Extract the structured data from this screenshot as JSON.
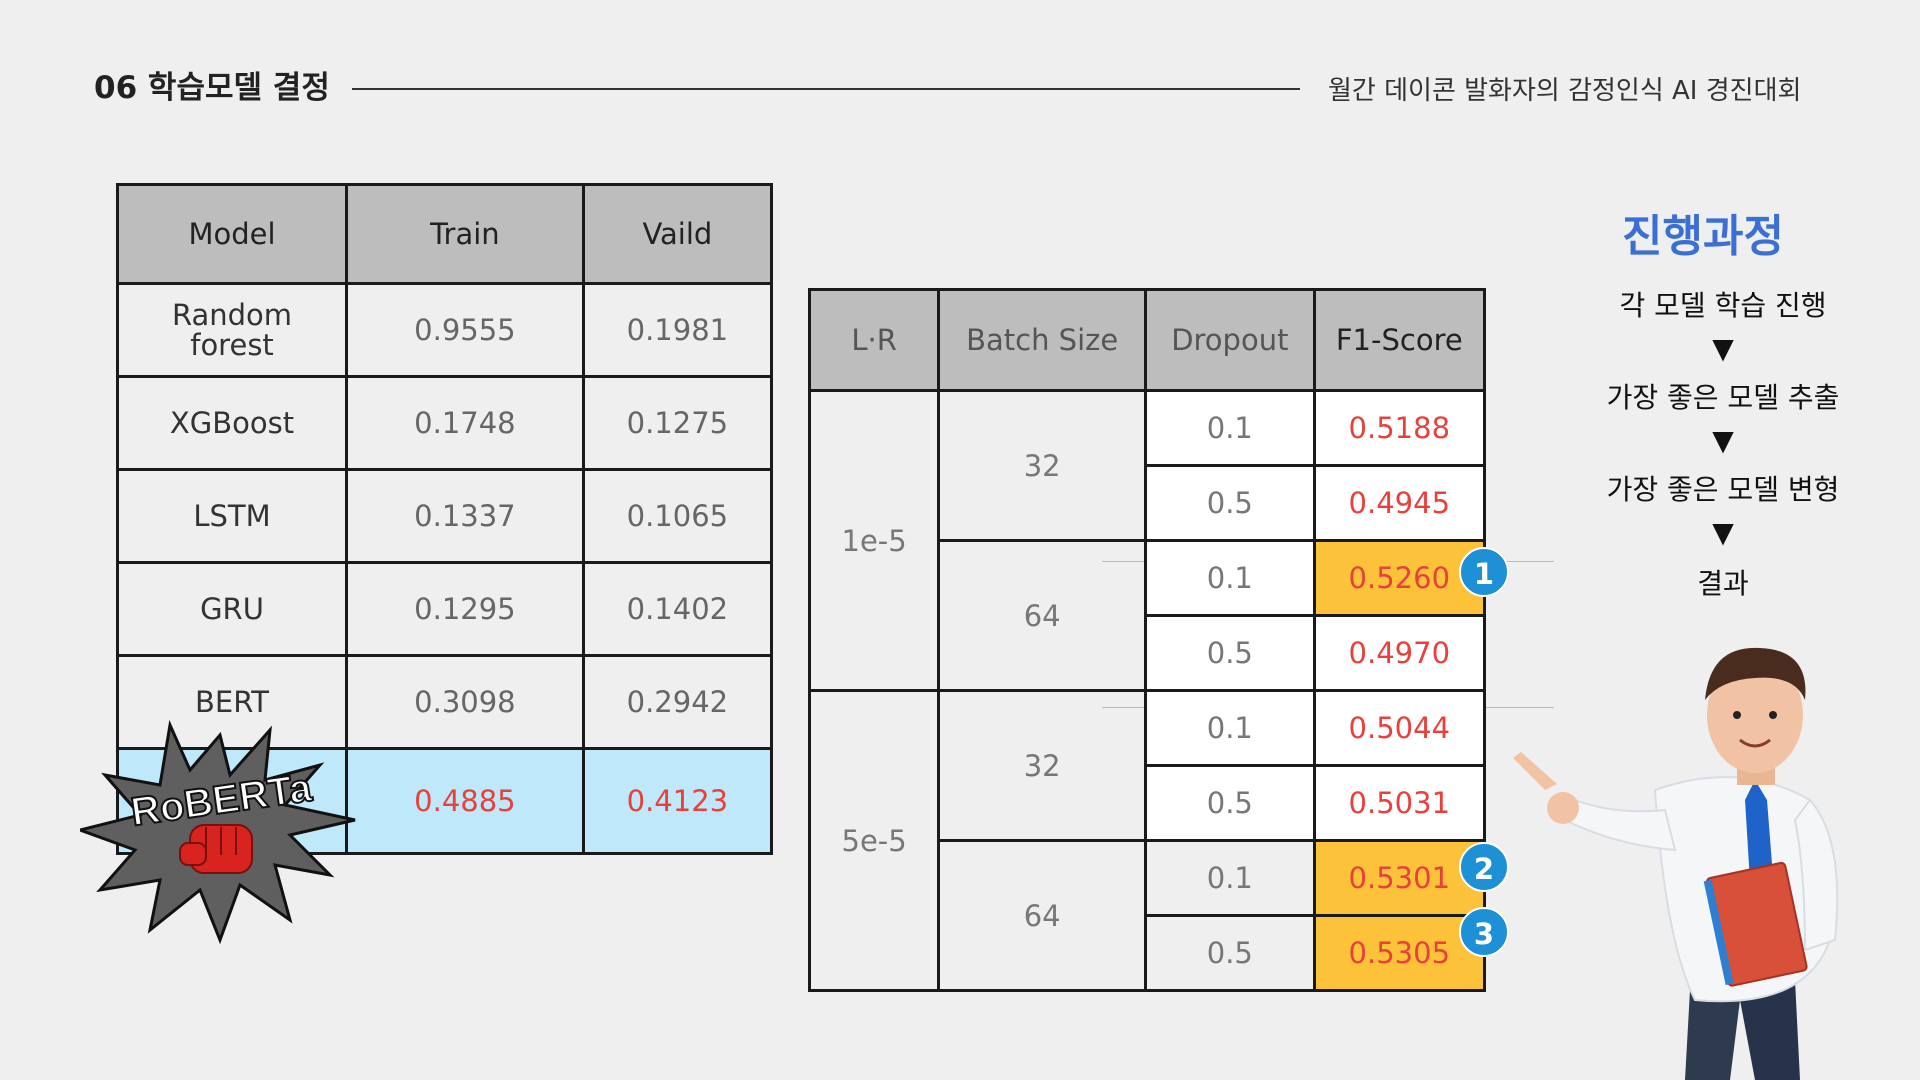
{
  "header": {
    "section_title": "06 학습모델 결정",
    "event_title": "월간 데이콘 발화자의 감정인식 AI 경진대회"
  },
  "model_table": {
    "headers": [
      "Model",
      "Train",
      "Vaild"
    ],
    "rows": [
      {
        "model": "Random\nforest",
        "train": "0.9555",
        "valid": "0.1981"
      },
      {
        "model": "XGBoost",
        "train": "0.1748",
        "valid": "0.1275"
      },
      {
        "model": "LSTM",
        "train": "0.1337",
        "valid": "0.1065"
      },
      {
        "model": "GRU",
        "train": "0.1295",
        "valid": "0.1402"
      },
      {
        "model": "BERT",
        "train": "0.3098",
        "valid": "0.2942"
      }
    ],
    "highlight_row": {
      "train": "0.4885",
      "valid": "0.4123"
    },
    "highlight_color": "#bfe8fb"
  },
  "roberta_badge": {
    "label": "RoBERTa"
  },
  "hp_table": {
    "headers": [
      "L·R",
      "Batch Size",
      "Dropout",
      "F1-Score"
    ],
    "lr_values": [
      "1e-5",
      "5e-5"
    ],
    "batch_values": [
      "32",
      "64",
      "32",
      "64"
    ],
    "rows": [
      {
        "dropout": "0.1",
        "f1": "0.5188"
      },
      {
        "dropout": "0.5",
        "f1": "0.4945"
      },
      {
        "dropout": "0.1",
        "f1": "0.5260"
      },
      {
        "dropout": "0.5",
        "f1": "0.4970"
      },
      {
        "dropout": "0.1",
        "f1": "0.5044"
      },
      {
        "dropout": "0.5",
        "f1": "0.5031"
      },
      {
        "dropout": "0.1",
        "f1": "0.5301"
      },
      {
        "dropout": "0.5",
        "f1": "0.5305"
      }
    ],
    "rank_badges": [
      "1",
      "2",
      "3"
    ],
    "highlight_color": "#fcc33a",
    "score_color": "#e8413c"
  },
  "process": {
    "title": "진행과정",
    "steps": [
      "각 모델 학습 진행",
      "가장 좋은 모델 추출",
      "가장 좋은 모델 변형",
      "결과"
    ],
    "arrow": "▼",
    "title_color": "#3b6fd4"
  }
}
